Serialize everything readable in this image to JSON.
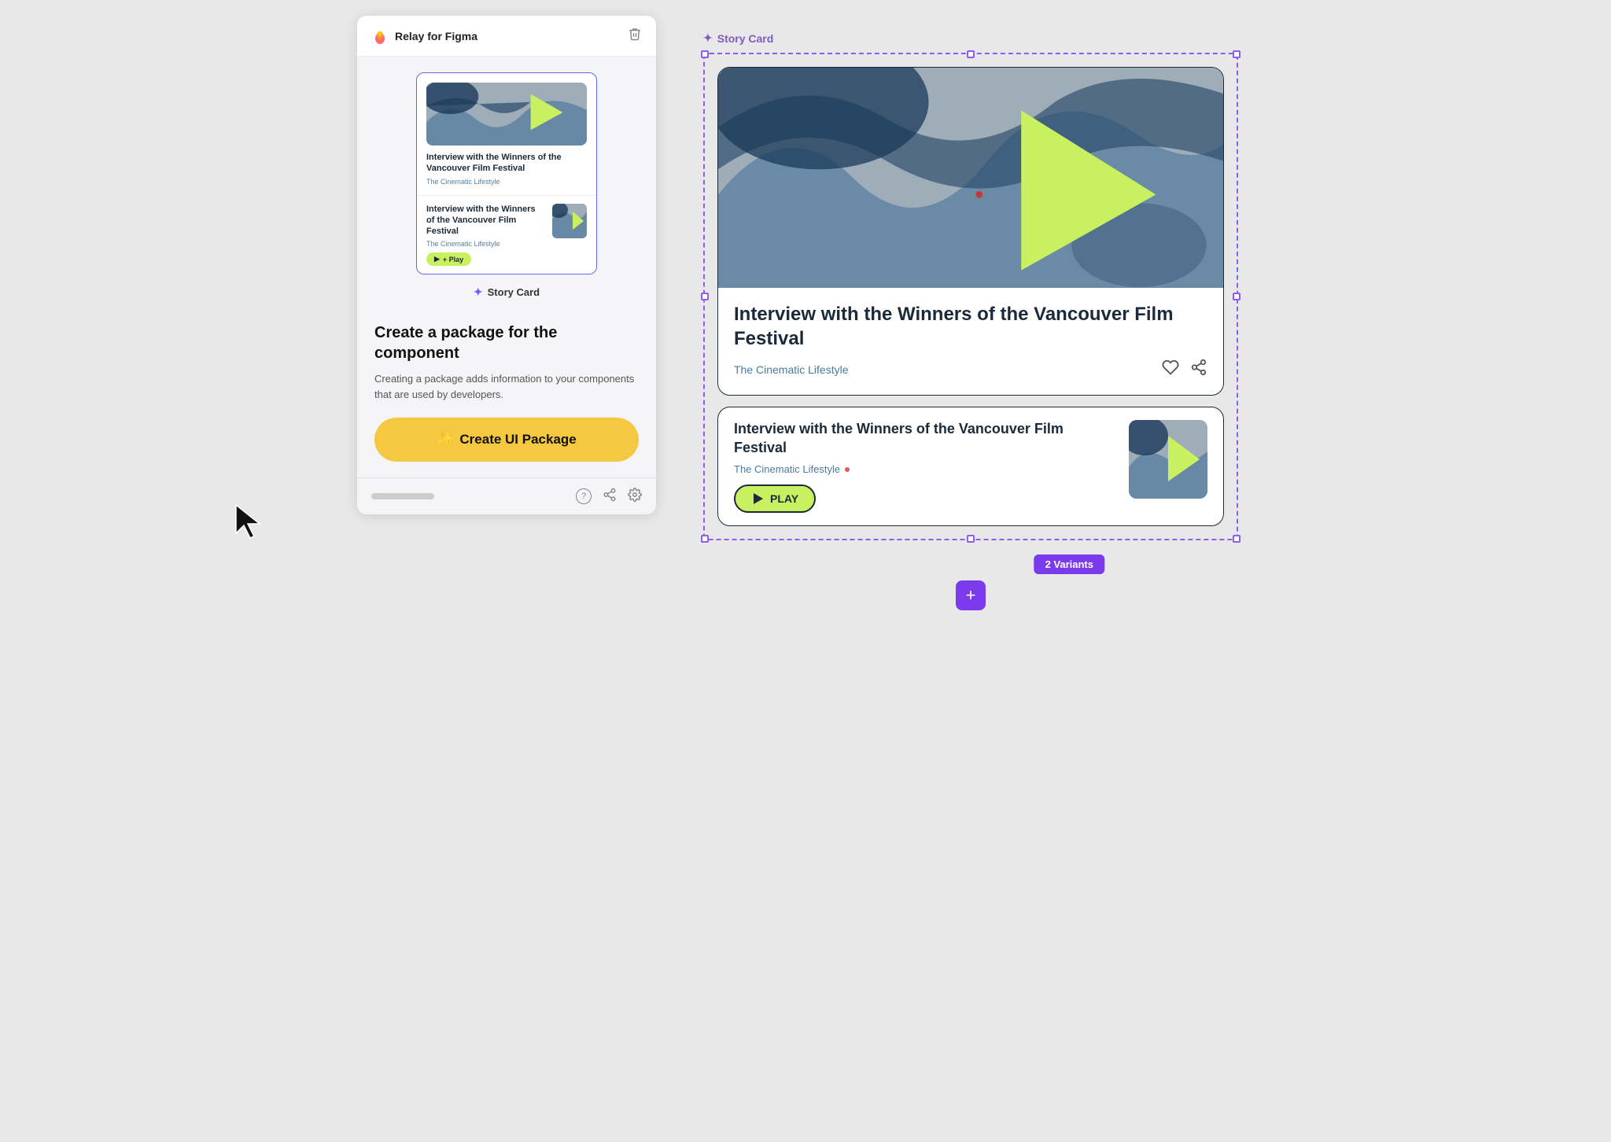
{
  "app": {
    "title": "Relay for Figma",
    "delete_icon": "🗑"
  },
  "left_panel": {
    "component_label": "Story Card",
    "package_heading": "Create a package for the component",
    "package_desc": "Creating a package adds information to your components that are used by developers.",
    "create_btn_label": "Create UI Package",
    "create_btn_icon": "✨"
  },
  "mini_cards": {
    "card1": {
      "title": "Interview with the Winners of the Vancouver Film Festival",
      "subtitle": "The Cinematic Lifestyle"
    },
    "card2": {
      "title": "Interview with the Winners of the Vancouver Film Festival",
      "subtitle": "The Cinematic Lifestyle",
      "play_label": "+ Play"
    }
  },
  "big_cards": {
    "card1": {
      "title": "Interview with the Winners of the Vancouver Film Festival",
      "source": "The Cinematic Lifestyle"
    },
    "card2": {
      "title": "Interview with the Winners of the Vancouver Film Festival",
      "source": "The Cinematic Lifestyle",
      "play_label": "PLAY"
    }
  },
  "story_card_label": "Story Card",
  "variants_badge": "2 Variants",
  "footer": {
    "help_icon": "?",
    "share_icon": "share",
    "settings_icon": "gear"
  }
}
